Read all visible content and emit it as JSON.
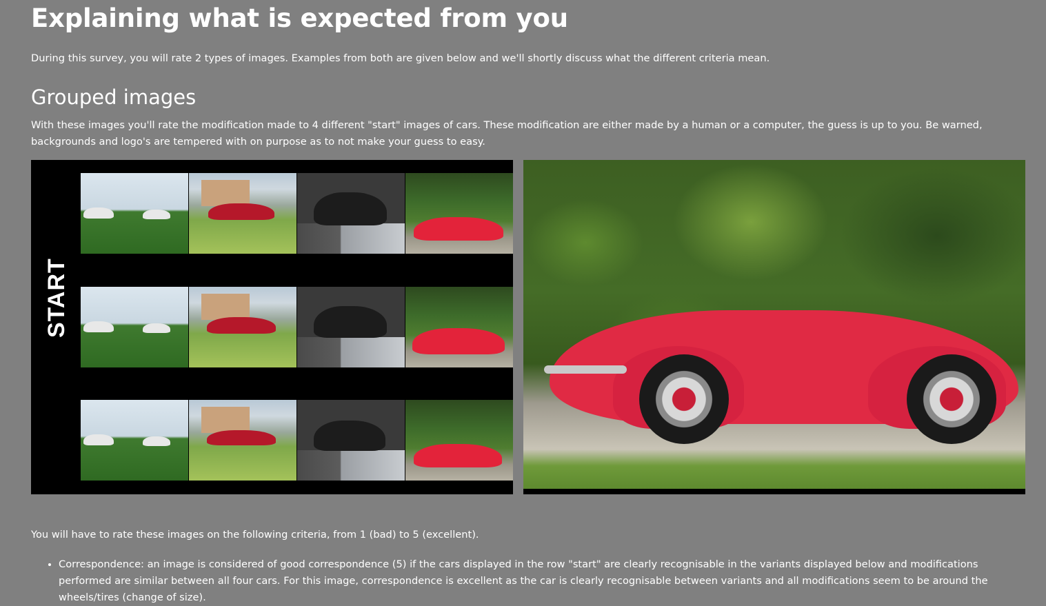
{
  "page": {
    "title": "Explaining what is expected from you",
    "intro": "During this survey, you will rate 2 types of images. Examples from both are given below and we'll shortly discuss what the different criteria mean."
  },
  "grouped": {
    "heading": "Grouped images",
    "description": "With these images you'll rate the modification made to 4 different \"start\" images of cars. These modification are either made by a human or a computer, the guess is up to you. Be warned, backgrounds and logo's are tempered with on purpose as to not make your guess to easy.",
    "start_label": "START",
    "tiles": [
      "white-sedans-field",
      "red-sedan-house",
      "black-hatchback-street",
      "red-roadster-hedge"
    ]
  },
  "criteria": {
    "intro": "You will have to rate these images on the following criteria, from 1 (bad) to 5 (excellent).",
    "items": [
      "Correspondence: an image is considered of good correspondence (5) if the cars displayed in the row \"start\" are clearly recognisable in the variants displayed below and modifications performed are similar between all four cars. For this image, correspondence is excellent as the car is clearly recognisable between variants and all modifications seem to be around the wheels/tires (change of size)."
    ]
  },
  "colors": {
    "background": "#808080",
    "text": "#ffffff",
    "panel": "#000000",
    "car_red": "#e02a44"
  }
}
